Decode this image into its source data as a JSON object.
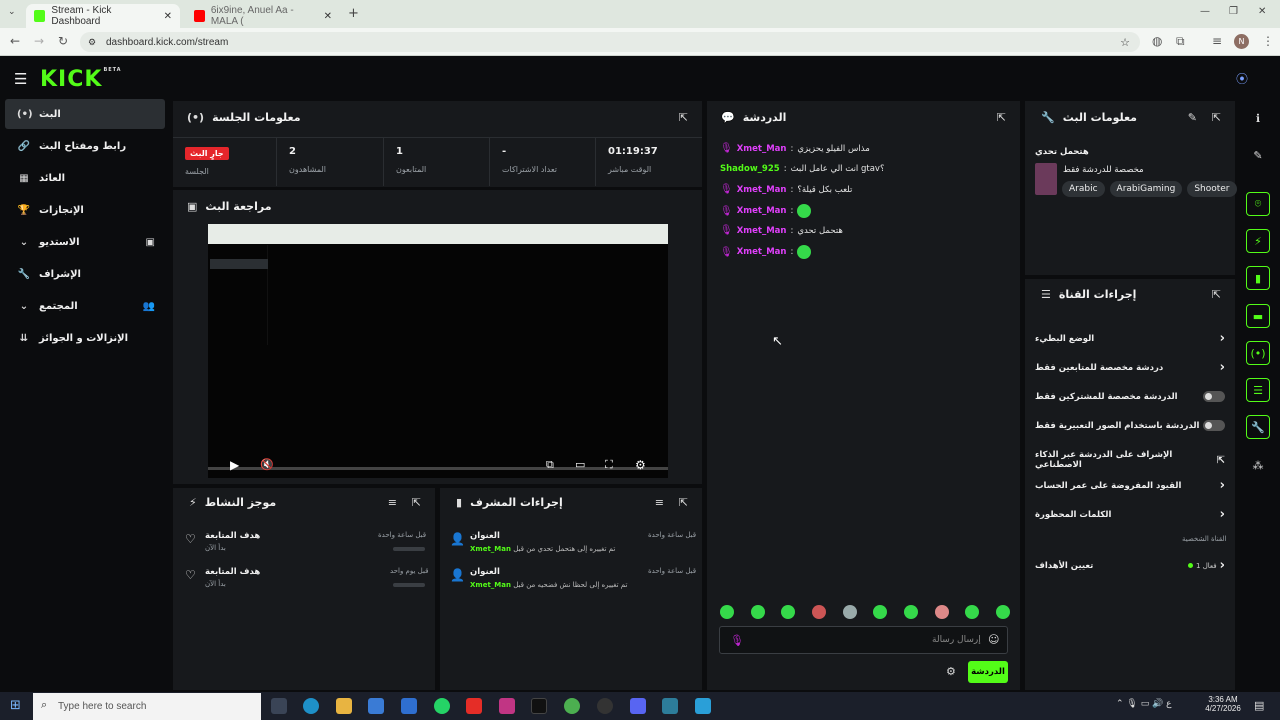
{
  "browser": {
    "tabs": [
      {
        "title": "Stream - Kick Dashboard"
      },
      {
        "title": "6ix9ine, Anuel Aa - MALA ("
      }
    ],
    "url": "dashboard.kick.com/stream",
    "profile_initial": "N"
  },
  "logo": {
    "text": "KICK",
    "badge": "BETA"
  },
  "sidebar": {
    "items": [
      {
        "label": "البث",
        "icon": "live-icon"
      },
      {
        "label": "رابط ومفتاح البث",
        "icon": "link-icon"
      },
      {
        "label": "العائد",
        "icon": "chart-icon"
      },
      {
        "label": "الإنجازات",
        "icon": "trophy-icon"
      },
      {
        "label": "الاستديو",
        "icon": "studio-icon"
      },
      {
        "label": "الإشراف",
        "icon": "wrench-icon"
      },
      {
        "label": "المجتمع",
        "icon": "community-icon"
      },
      {
        "label": "الإنزالات و الجوائز",
        "icon": "drops-icon"
      }
    ]
  },
  "session": {
    "title": "معلومات الجلسة",
    "live_badge": "جارٍ البث",
    "live_label": "الجلسة",
    "stats": [
      {
        "value": "2",
        "label": "المشاهدون"
      },
      {
        "value": "1",
        "label": "المتابعون"
      },
      {
        "value": "-",
        "label": "تعداد الاشتراكات"
      },
      {
        "value": "01:19:37",
        "label": "الوقت مباشر"
      }
    ]
  },
  "preview": {
    "title": "مراجعة البث"
  },
  "activity": {
    "title": "موجز النشاط",
    "items": [
      {
        "title": "هدف المتابعة",
        "sub": "بدأ الآن",
        "time": "قبل ساعة واحدة"
      },
      {
        "title": "هدف المتابعة",
        "sub": "بدأ الآن",
        "time": "قبل يوم واحد"
      }
    ]
  },
  "modactions": {
    "title": "إجراءات المشرف",
    "items": [
      {
        "title": "العنوان",
        "by": "Xmet_Man",
        "desc": "تم تغييره إلى هتحمل تحدي من قبل",
        "time": "قبل ساعة واحدة"
      },
      {
        "title": "العنوان",
        "by": "Xmet_Man",
        "desc": "تم تغييره إلى لحظا نش فضحيه من قبل",
        "time": "قبل ساعة واحدة"
      }
    ]
  },
  "chat": {
    "title": "الدردشة",
    "messages": [
      {
        "user": "Xmet_Man",
        "text": "مذاس الفيلو يحزيزي"
      },
      {
        "user": "Shadow_925",
        "text": "انت الي عامل البث gtav؟"
      },
      {
        "user": "Xmet_Man",
        "text": "تلعب بكل قيلة؟"
      },
      {
        "user": "Xmet_Man",
        "text": ""
      },
      {
        "user": "Xmet_Man",
        "text": "هتحمل تحدي"
      },
      {
        "user": "Xmet_Man",
        "text": ""
      }
    ],
    "input_placeholder": "إرسال رسالة",
    "send_label": "الدردشة"
  },
  "streaminfo": {
    "title": "معلومات البث",
    "stream_title": "هتحمل تحدي",
    "category": "مخصصة للدردشة فقط",
    "tags": [
      "Arabic",
      "ArabiGaming",
      "Shooter"
    ]
  },
  "channel": {
    "title": "إجراءات القناة",
    "rows": [
      {
        "label": "الوضع البطيء",
        "type": "arrow"
      },
      {
        "label": "دردشة مخصصة للمتابعين فقط",
        "type": "arrow"
      },
      {
        "label": "الدردشة مخصصة للمشتركين فقط",
        "type": "toggle"
      },
      {
        "label": "الدردشة باستخدام الصور التعبيرية فقط",
        "type": "toggle"
      },
      {
        "label": "الإشراف على الدردشة عبر الذكاء الاصطناعي",
        "type": "external"
      },
      {
        "label": "القيود المفروضة على عمر الحساب",
        "type": "arrow"
      },
      {
        "label": "الكلمات المحظورة",
        "type": "arrow"
      }
    ],
    "section_label": "القناة الشخصية",
    "goals_label": "تعيين الأهداف",
    "goals_count": "1 فعال"
  },
  "taskbar": {
    "search_placeholder": "Type here to search",
    "time": "3:36 AM",
    "date": "4/27/2026"
  },
  "colors": {
    "accent": "#53fc18",
    "username": "#e040fb",
    "live": "#e5262b"
  }
}
